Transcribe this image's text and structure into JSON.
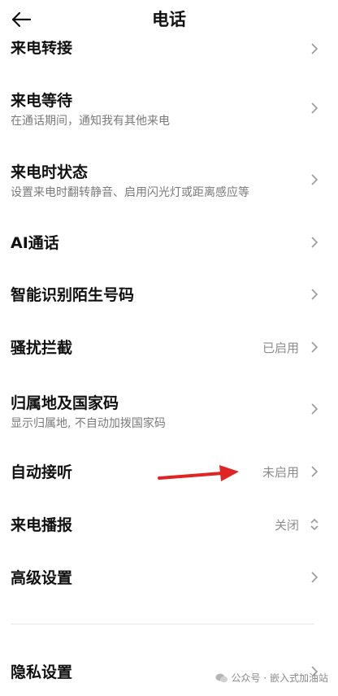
{
  "header": {
    "title": "电话"
  },
  "rows": [
    {
      "title": "来电转接"
    },
    {
      "title": "来电等待",
      "subtitle": "在通话期间，通知我有其他来电"
    },
    {
      "title": "来电时状态",
      "subtitle": "设置来电时翻转静音、启用闪光灯或距离感应等"
    },
    {
      "title": "AI通话"
    },
    {
      "title": "智能识别陌生号码"
    },
    {
      "title": "骚扰拦截",
      "value": "已启用"
    },
    {
      "title": "归属地及国家码",
      "subtitle": "显示归属地, 不自动加拨国家码"
    },
    {
      "title": "自动接听",
      "value": "未启用"
    },
    {
      "title": "来电播报",
      "value": "关闭"
    },
    {
      "title": "高级设置"
    },
    {
      "title": "隐私设置"
    }
  ],
  "watermark": {
    "text": "公众号 · 嵌入式加油站"
  },
  "colors": {
    "annotation_arrow": "#e02424",
    "chevron": "#9a9a9a",
    "secondary_text": "#7a7a7a"
  }
}
